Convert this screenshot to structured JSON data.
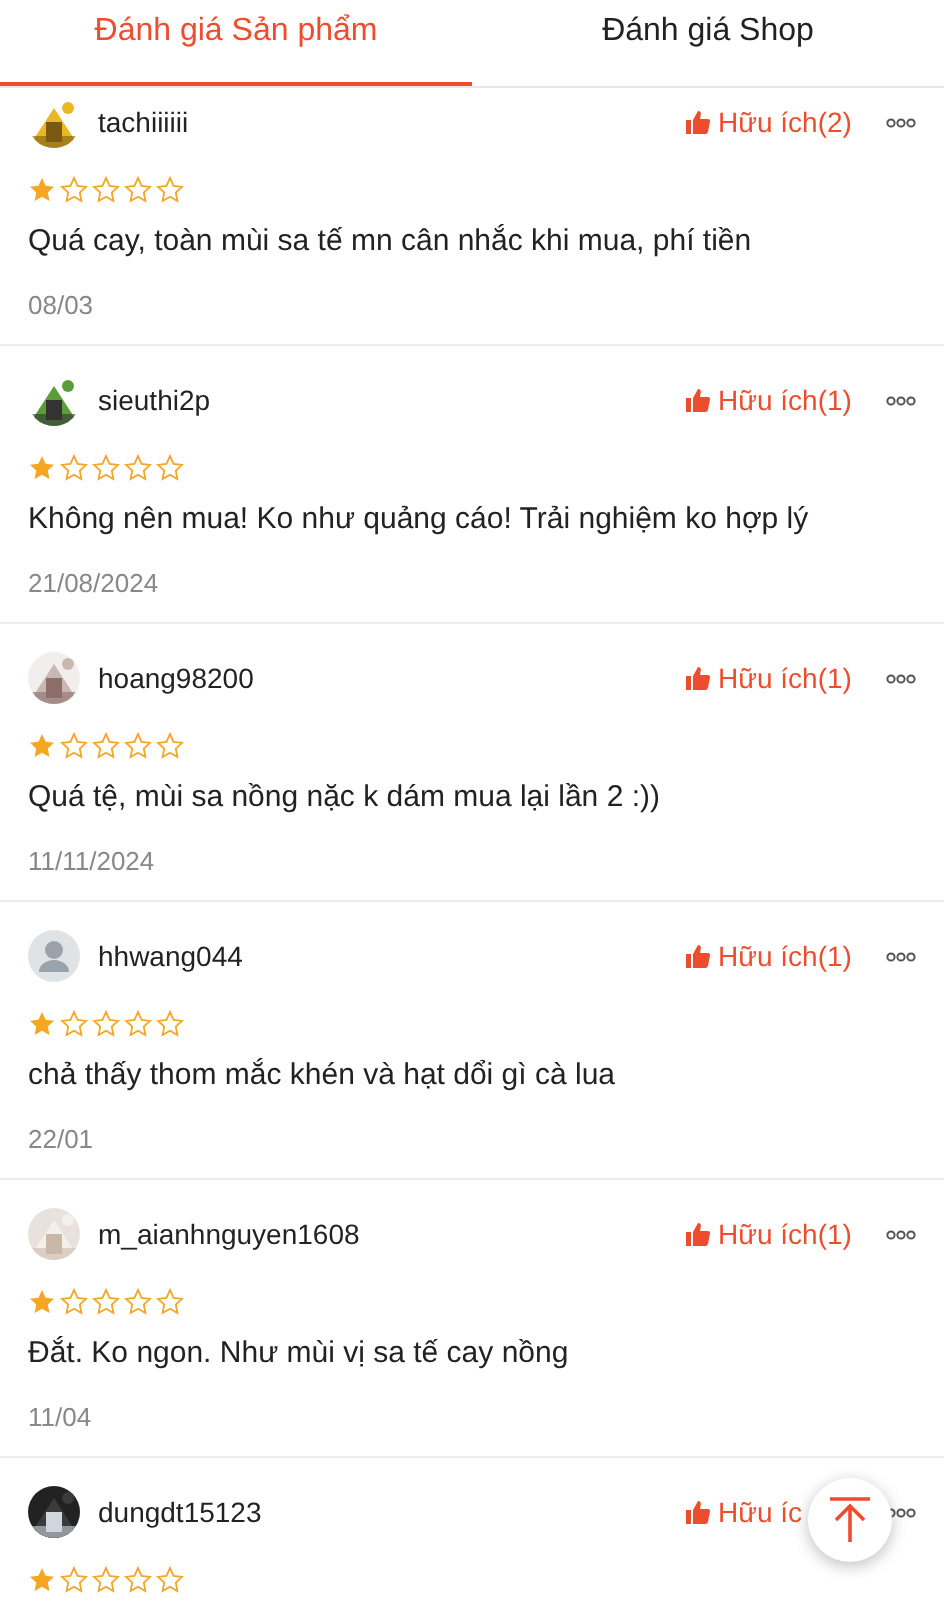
{
  "tabs": [
    {
      "label": "Đánh giá Sản phẩm",
      "selected": true
    },
    {
      "label": "Đánh giá Shop",
      "selected": false
    }
  ],
  "reviews": [
    {
      "username": "tachiiiiii",
      "helpful": "Hữu ích(2)",
      "stars": 1,
      "text": "Quá cay, toàn mùi sa tế mn cân nhắc khi mua, phí tiền",
      "date": "08/03"
    },
    {
      "username": "sieuthi2p",
      "helpful": "Hữu ích(1)",
      "stars": 1,
      "text": "Không nên mua! Ko như quảng cáo! Trải nghiệm ko hợp lý",
      "date": "21/08/2024"
    },
    {
      "username": "hoang98200",
      "helpful": "Hữu ích(1)",
      "stars": 1,
      "text": "Quá tệ, mùi sa nồng nặc k dám mua lại lần 2 :))",
      "date": "11/11/2024"
    },
    {
      "avatar": {
        "kind": "default"
      },
      "username": "hhwang044",
      "helpful": "Hữu ích(1)",
      "stars": 1,
      "text": "chả thấy thom mắc khén và hạt dổi gì cà lua",
      "date": "22/01"
    },
    {
      "username": "m_aianhnguyen1608",
      "helpful": "Hữu ích(1)",
      "stars": 1,
      "text": "Đắt. Ko ngon. Như mùi vị sa tế cay nồng",
      "date": "11/04"
    },
    {
      "username": "dungdt15123",
      "helpful": "Hữu íc",
      "stars": 1
    }
  ]
}
